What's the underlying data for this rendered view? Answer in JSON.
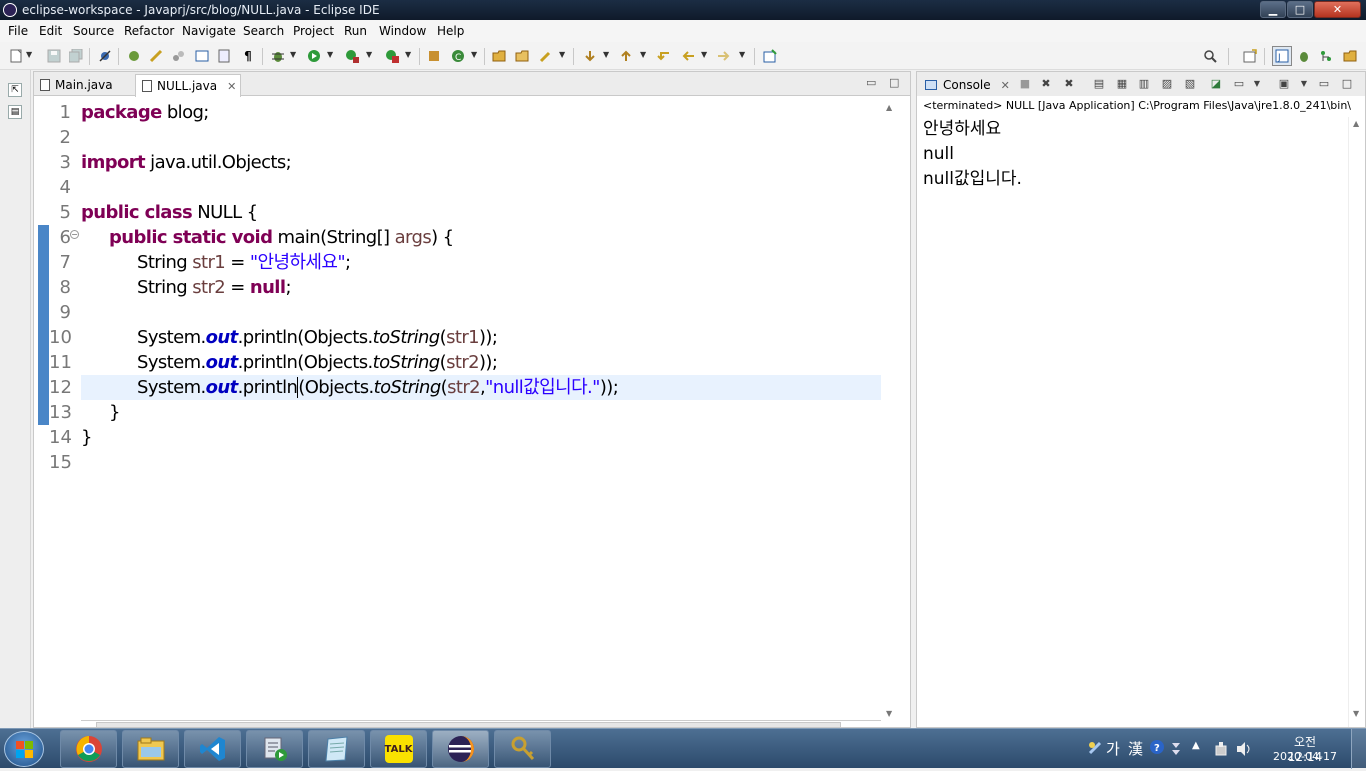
{
  "window": {
    "title": "eclipse-workspace - Javaprj/src/blog/NULL.java - Eclipse IDE",
    "controls": {
      "minimize": "▁",
      "maximize": "□",
      "close": "✕"
    }
  },
  "menu": [
    "File",
    "Edit",
    "Source",
    "Refactor",
    "Navigate",
    "Search",
    "Project",
    "Run",
    "Window",
    "Help"
  ],
  "editor": {
    "tabs": [
      {
        "label": "Main.java",
        "active": false
      },
      {
        "label": "NULL.java",
        "active": true
      }
    ],
    "current_line": 12,
    "line_numbers": [
      "1",
      "2",
      "3",
      "4",
      "5",
      "6",
      "7",
      "8",
      "9",
      "10",
      "11",
      "12",
      "13",
      "14",
      "15"
    ],
    "code": {
      "l1_kw": "package",
      "l1_rest": " blog;",
      "l3_kw": "import",
      "l3_rest": " java.util.Objects;",
      "l5_kw": "public class",
      "l5_rest": " NULL {",
      "l6_kw": "public static void",
      "l6_a": " main(String[] ",
      "l6_var": "args",
      "l6_b": ") {",
      "l7_a": "String ",
      "l7_var": "str1",
      "l7_b": " = ",
      "l7_str": "\"안녕하세요\"",
      "l7_c": ";",
      "l8_a": "String ",
      "l8_var": "str2",
      "l8_b": " = ",
      "l8_kw": "null",
      "l8_c": ";",
      "l10_a": "System.",
      "l10_fld": "out",
      "l10_b": ".println(Objects.",
      "l10_st": "toString",
      "l10_c": "(",
      "l10_var": "str1",
      "l10_d": "));",
      "l11_a": "System.",
      "l11_fld": "out",
      "l11_b": ".println(Objects.",
      "l11_st": "toString",
      "l11_c": "(",
      "l11_var": "str2",
      "l11_d": "));",
      "l12_a": "System.",
      "l12_fld": "out",
      "l12_b": ".println",
      "l12_paren": "(",
      "l12_c": "Objects.",
      "l12_st": "toString",
      "l12_d": "(",
      "l12_var": "str2",
      "l12_e": ",",
      "l12_str": "\"null값입니다.\"",
      "l12_f": "));",
      "l13": "}",
      "l14": "}"
    }
  },
  "console": {
    "tab_label": "Console",
    "status": "<terminated> NULL [Java Application] C:\\Program Files\\Java\\jre1.8.0_241\\bin\\",
    "output": [
      "안녕하세요",
      "null",
      "null값입니다."
    ]
  },
  "taskbar": {
    "apps": [
      "chrome-icon",
      "file-explorer-icon",
      "vscode-icon",
      "task-scheduler-icon",
      "notepad-icon",
      "kakaotalk-icon",
      "eclipse-icon",
      "key-tool-icon"
    ],
    "kakao_label": "TALK",
    "ime_ga": "가",
    "ime_han": "漢",
    "time": "오전 12:14",
    "date": "2020-04-17"
  },
  "colors": {
    "keyword": "#7f0055",
    "string": "#2a00ff",
    "field": "#0000c0",
    "variable": "#6a3e3e",
    "current_line": "#e8f2fe"
  }
}
